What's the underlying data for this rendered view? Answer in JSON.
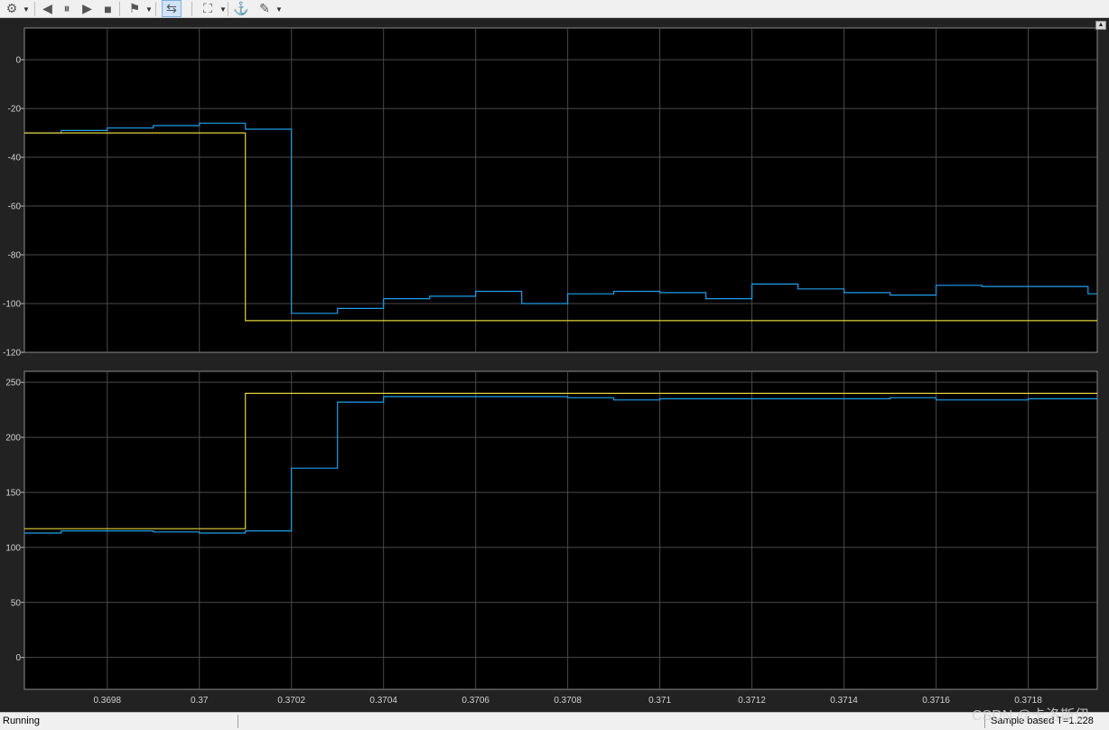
{
  "toolbar": {
    "buttons": [
      {
        "name": "settings-button",
        "icon": "gear-icon",
        "glyph": "⚙",
        "dropdown": true
      },
      {
        "name": "step-back-button",
        "icon": "step-back-icon",
        "glyph": "◀",
        "dropdown": false
      },
      {
        "name": "pause-button",
        "icon": "pause-icon",
        "glyph": "⏸",
        "dropdown": false
      },
      {
        "name": "step-forward-button",
        "icon": "step-forward-icon",
        "glyph": "▶",
        "dropdown": false
      },
      {
        "name": "stop-button",
        "icon": "stop-icon",
        "glyph": "■",
        "dropdown": false
      },
      {
        "name": "highlight-button",
        "icon": "highlight-block-icon",
        "glyph": "⚑",
        "dropdown": true
      },
      {
        "name": "zoom-button",
        "icon": "zoom-icon",
        "glyph": "⇆",
        "dropdown": false,
        "active": true
      },
      {
        "name": "autoscale-button",
        "icon": "autoscale-icon",
        "glyph": "⛶",
        "dropdown": true
      },
      {
        "name": "triggers-button",
        "icon": "trigger-icon",
        "glyph": "⚓",
        "dropdown": false
      },
      {
        "name": "measurements-button",
        "icon": "measure-icon",
        "glyph": "✎",
        "dropdown": true
      }
    ]
  },
  "status": {
    "left": "Running",
    "right": "Sample based   T=1.228"
  },
  "watermark": "CSDN @卡洛斯伊",
  "colors": {
    "axes_bg": "#000000",
    "figure_bg": "#222222",
    "grid": "#4a4a4a",
    "tick_text": "#d0d0d0",
    "series_blue": "#1f9eea",
    "series_yellow": "#e3d23a"
  },
  "chart_data": [
    {
      "type": "line",
      "xlim": [
        0.36962,
        0.37195
      ],
      "ylim": [
        -120,
        13
      ],
      "grid": true,
      "xticks": [
        0.3698,
        0.37,
        0.3702,
        0.3704,
        0.3706,
        0.3708,
        0.371,
        0.3712,
        0.3714,
        0.3716,
        0.3718
      ],
      "yticks": [
        0,
        -20,
        -40,
        -60,
        -80,
        -100,
        -120
      ],
      "show_xtick_labels": false,
      "series": [
        {
          "color": "blue",
          "step": true,
          "x": [
            0.36962,
            0.3697,
            0.3698,
            0.3699,
            0.37,
            0.3701,
            0.3702,
            0.3703,
            0.3704,
            0.3705,
            0.3706,
            0.3707,
            0.3708,
            0.3709,
            0.371,
            0.3711,
            0.3712,
            0.3713,
            0.3714,
            0.3715,
            0.3716,
            0.3717,
            0.3718,
            0.37193,
            0.37195
          ],
          "y": [
            -30,
            -29,
            -28,
            -27,
            -26,
            -28.5,
            -104,
            -102,
            -98,
            -97,
            -95,
            -100,
            -96,
            -95,
            -95.5,
            -98,
            -92,
            -94,
            -95.5,
            -96.5,
            -92.5,
            -93,
            -93,
            -96,
            -96
          ]
        },
        {
          "color": "yellow",
          "step": true,
          "x": [
            0.36962,
            0.3701,
            0.37195
          ],
          "y": [
            -30,
            -107,
            -107
          ]
        }
      ]
    },
    {
      "type": "line",
      "xlim": [
        0.36962,
        0.37195
      ],
      "ylim": [
        -29,
        260
      ],
      "grid": true,
      "xticks": [
        0.3698,
        0.37,
        0.3702,
        0.3704,
        0.3706,
        0.3708,
        0.371,
        0.3712,
        0.3714,
        0.3716,
        0.3718
      ],
      "xtick_labels": [
        "0.3698",
        "0.37",
        "0.3702",
        "0.3704",
        "0.3706",
        "0.3708",
        "0.371",
        "0.3712",
        "0.3714",
        "0.3716",
        "0.3718"
      ],
      "yticks": [
        250,
        200,
        150,
        100,
        50,
        0
      ],
      "show_xtick_labels": true,
      "series": [
        {
          "color": "blue",
          "step": true,
          "x": [
            0.36962,
            0.3697,
            0.3698,
            0.3699,
            0.37,
            0.3701,
            0.3702,
            0.3703,
            0.3704,
            0.3705,
            0.3706,
            0.3707,
            0.3708,
            0.3709,
            0.371,
            0.3711,
            0.3712,
            0.3713,
            0.3714,
            0.3715,
            0.3716,
            0.3717,
            0.3718,
            0.37195
          ],
          "y": [
            113,
            115,
            115,
            114,
            113,
            115,
            172,
            232,
            237,
            237,
            237,
            237,
            236,
            234,
            235,
            235,
            235,
            235,
            235,
            236,
            234,
            234,
            235,
            235
          ]
        },
        {
          "color": "yellow",
          "step": true,
          "x": [
            0.36962,
            0.3701,
            0.37195
          ],
          "y": [
            117,
            240,
            240
          ]
        }
      ]
    }
  ]
}
